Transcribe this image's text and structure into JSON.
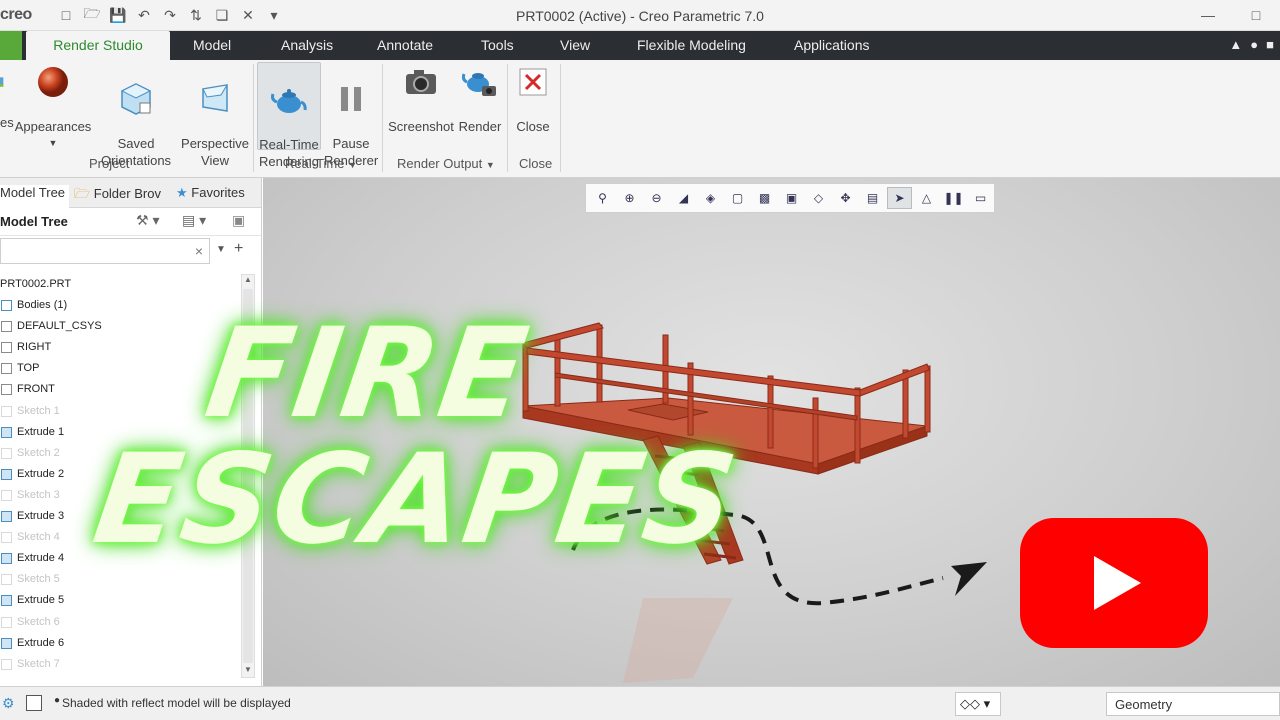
{
  "app": {
    "logo": "creo",
    "window_title": "PRT0002 (Active) - Creo Parametric 7.0"
  },
  "tabs": [
    {
      "label": "Render Studio",
      "active": true
    },
    {
      "label": "Model"
    },
    {
      "label": "Analysis"
    },
    {
      "label": "Annotate"
    },
    {
      "label": "Tools"
    },
    {
      "label": "View"
    },
    {
      "label": "Flexible Modeling"
    },
    {
      "label": "Applications"
    }
  ],
  "ribbon": {
    "project": {
      "label": "Project",
      "scenes_label": "es",
      "appearances_label": "Appearances",
      "saved_orientations_label": "Saved\nOrientations",
      "perspective_view_label": "Perspective\nView"
    },
    "realtime": {
      "label": "Real-Time",
      "realtime_rendering_label": "Real-Time\nRendering",
      "pause_renderer_label": "Pause\nRenderer"
    },
    "render_output": {
      "label": "Render Output",
      "screenshot_label": "Screenshot",
      "render_label": "Render"
    },
    "close": {
      "label": "Close",
      "close_label": "Close"
    }
  },
  "left_panel": {
    "tabs": [
      "Model Tree",
      "Folder Brov",
      "Favorites"
    ],
    "header": "Model Tree",
    "tree": [
      {
        "label": "PRT0002.PRT",
        "icon": "part-icon",
        "dim": false
      },
      {
        "label": "Bodies (1)",
        "icon": "bodies-icon",
        "dim": false
      },
      {
        "label": "DEFAULT_CSYS",
        "icon": "csys-icon",
        "dim": false
      },
      {
        "label": "RIGHT",
        "icon": "datum-plane-icon",
        "dim": false
      },
      {
        "label": "TOP",
        "icon": "datum-plane-icon",
        "dim": false
      },
      {
        "label": "FRONT",
        "icon": "datum-plane-icon",
        "dim": false
      },
      {
        "label": "Sketch 1",
        "icon": "sketch-icon",
        "dim": true
      },
      {
        "label": "Extrude 1",
        "icon": "extrude-icon",
        "dim": false
      },
      {
        "label": "Sketch 2",
        "icon": "sketch-icon",
        "dim": true
      },
      {
        "label": "Extrude 2",
        "icon": "extrude-icon",
        "dim": false
      },
      {
        "label": "Sketch 3",
        "icon": "sketch-icon",
        "dim": true
      },
      {
        "label": "Extrude 3",
        "icon": "extrude-icon",
        "dim": false
      },
      {
        "label": "Sketch 4",
        "icon": "sketch-icon",
        "dim": true
      },
      {
        "label": "Extrude 4",
        "icon": "extrude-icon",
        "dim": false
      },
      {
        "label": "Sketch 5",
        "icon": "sketch-icon",
        "dim": true
      },
      {
        "label": "Extrude 5",
        "icon": "extrude-icon",
        "dim": false
      },
      {
        "label": "Sketch 6",
        "icon": "sketch-icon",
        "dim": true
      },
      {
        "label": "Extrude 6",
        "icon": "extrude-icon",
        "dim": false
      },
      {
        "label": "Sketch 7",
        "icon": "sketch-icon",
        "dim": true
      }
    ]
  },
  "overlay": {
    "line1": "FIRE",
    "line2": "ESCAPES",
    "glow_color": "#5ef035"
  },
  "model_color": "#c2492f",
  "status": {
    "message": "Shaded with reflect model will be displayed",
    "filter": "Geometry"
  },
  "colors": {
    "accent_green": "#2d8a2d",
    "file_tab": "#58a83a",
    "tabbar": "#2b2f33",
    "youtube_red": "#ff0000"
  }
}
